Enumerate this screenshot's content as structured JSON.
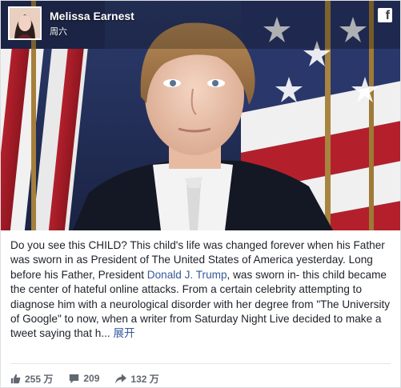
{
  "post": {
    "author": "Melissa Earnest",
    "date": "周六",
    "text_before_link": "Do you see this CHILD? This child's life was changed forever when his Father was sworn in as President of The United States of America yesterday. Long before his Father, President ",
    "link_text": "Donald J. Trump",
    "text_after_link": ", was sworn in- this child became the center of hateful online attacks. From a certain celebrity attempting to diagnose him with a neurological disorder with her degree from \"The University of Google\" to now, when a writer from Saturday Night Live decided to make a tweet saying that h...",
    "see_more": "展开"
  },
  "icons": {
    "header": "facebook-icon",
    "likes": "thumbs-up-icon",
    "comments": "comment-icon",
    "shares": "share-arrow-icon"
  },
  "stats": {
    "likes": "255 万",
    "comments": "209",
    "shares": "132 万"
  },
  "colors": {
    "link": "#365899",
    "text": "#1d2129",
    "stats": "#606770"
  }
}
